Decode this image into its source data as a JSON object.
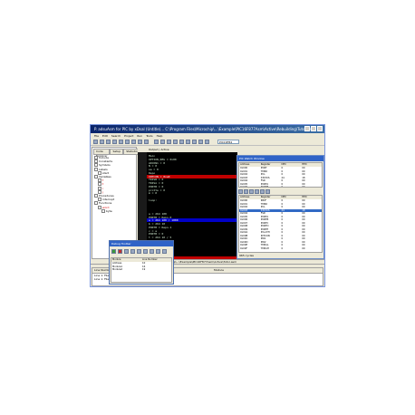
{
  "window": {
    "title": "P. adsuAsm for PIC by xDsal (Untitle)... C:\\Program Files\\Microchip\\...\\Example\\PIC16F877Asm\\Active\\Rebuilding\\Tutor.asm",
    "menu": [
      "File",
      "Edit",
      "Search",
      "Project",
      "Run",
      "Tools",
      "Help"
    ],
    "toolbar_combo": "PIC16F84"
  },
  "left_pane": {
    "tabs": [
      "Code Explorer",
      "Setup",
      "Statistics"
    ],
    "tree": [
      {
        "label": "Include",
        "depth": 1,
        "red": false
      },
      {
        "label": "Constants",
        "depth": 1,
        "red": false
      },
      {
        "label": "Symbols",
        "depth": 1,
        "red": false
      },
      {
        "label": "Labels",
        "depth": 1,
        "red": false
      },
      {
        "label": "start",
        "depth": 2,
        "red": false
      },
      {
        "label": "Variables",
        "depth": 1,
        "red": false
      },
      {
        "label": "f",
        "depth": 2,
        "red": true
      },
      {
        "label": "t",
        "depth": 2,
        "red": true
      },
      {
        "label": "i",
        "depth": 2,
        "red": true
      },
      {
        "label": "j",
        "depth": 2,
        "red": true
      },
      {
        "label": "Procedures",
        "depth": 1,
        "red": false
      },
      {
        "label": "interrupt",
        "depth": 2,
        "red": false
      },
      {
        "label": "Functions",
        "depth": 1,
        "red": false
      },
      {
        "label": "word",
        "depth": 2,
        "red": true
      },
      {
        "label": "byte",
        "depth": 3,
        "red": false
      }
    ]
  },
  "editor": {
    "tab": "Output | Active",
    "lines": [
      {
        "text": "Main",
        "hl": ""
      },
      {
        "text": "OPTION_REG = 0x00",
        "hl": ""
      },
      {
        "text": "ADCON1 = 0",
        "hl": ""
      },
      {
        "text": "N = 0",
        "hl": ""
      },
      {
        "text": "sa = 0",
        "hl": ""
      },
      {
        "text": "Repo",
        "hl": ""
      },
      {
        "text": "INTCON = 0xa0",
        "hl": "red"
      },
      {
        "text": "TRISB = 0",
        "hl": ""
      },
      {
        "text": "TRISA = 0",
        "hl": ""
      },
      {
        "text": "PORTB = 0",
        "hl": ""
      },
      {
        "text": "protte = 0",
        "hl": ""
      },
      {
        "text": "m = 0",
        "hl": ""
      },
      {
        "text": "",
        "hl": ""
      },
      {
        "text": "loop:",
        "hl": ""
      },
      {
        "text": "",
        "hl": ""
      },
      {
        "text": "",
        "hl": ""
      },
      {
        "text": "",
        "hl": ""
      },
      {
        "text": "  a = d64 100",
        "hl": ""
      },
      {
        "text": "  PORTB = Repo.0",
        "hl": ""
      },
      {
        "text": "  a = d64 100 / 1000",
        "hl": "blue"
      },
      {
        "text": "  b = d64 10",
        "hl": ""
      },
      {
        "text": "  PORTB = Repo.1",
        "hl": ""
      },
      {
        "text": "  c = a",
        "hl": ""
      },
      {
        "text": "  PORTB = 0",
        "hl": ""
      },
      {
        "text": "  t = d64 10 / 5",
        "hl": ""
      },
      {
        "text": "  PORTB = Repo.2",
        "hl": ""
      },
      {
        "text": "  PORTB = 0",
        "hl": ""
      },
      {
        "text": "  PORTB AD = 0",
        "hl": ""
      },
      {
        "text": "  PORTB = 0",
        "hl": ""
      },
      {
        "text": "  PORTB = 0",
        "hl": ""
      },
      {
        "text": "  INT = Sleep",
        "hl": "red"
      }
    ],
    "bottom_path": "C:\\Program Files\\Microchip\\...\\Example\\PIC16F877Asm\\Active\\Tutor.asm"
  },
  "debug_panel": {
    "title": "PIC Watch Window",
    "table1": {
      "headers": [
        "Address",
        "Register",
        "DEC",
        "HEX"
      ],
      "rows": [
        [
          "0x000",
          "PORT",
          "0",
          "00"
        ],
        [
          "0x001",
          "TMR0",
          "0",
          "00"
        ],
        [
          "0x002",
          "PCL",
          "0",
          "00"
        ],
        [
          "0x003",
          "STATUS",
          "24",
          "18"
        ],
        [
          "0x004",
          "FSR",
          "0",
          "00"
        ],
        [
          "0x005",
          "PORTA",
          "0",
          "00"
        ],
        [
          "0x006",
          "PORTB",
          "0",
          "00"
        ]
      ]
    },
    "table2": {
      "headers": [
        "Address",
        "Register",
        "DEC",
        "HEX"
      ],
      "rows": [
        [
          "0x000",
          "INDF",
          "0",
          "00"
        ],
        [
          "0x001",
          "TMR0",
          "0",
          "00"
        ],
        [
          "0x002",
          "PCL",
          "0",
          "00"
        ],
        [
          "0x003",
          "STATUS",
          "24",
          "18"
        ],
        [
          "0x004",
          "FSR",
          "0",
          "00"
        ],
        [
          "0x005",
          "PORTA",
          "0",
          "00"
        ],
        [
          "0x006",
          "PORTB",
          "0",
          "00"
        ],
        [
          "0x007",
          "PORTC",
          "0",
          "00"
        ],
        [
          "0x008",
          "PORTD",
          "0",
          "00"
        ],
        [
          "0x009",
          "PORTE",
          "0",
          "00"
        ],
        [
          "0x00A",
          "PCLATH",
          "0",
          "00"
        ],
        [
          "0x00B",
          "INTCON",
          "0",
          "00"
        ],
        [
          "0x00C",
          "PIR1",
          "0",
          "00"
        ],
        [
          "0x00D",
          "PIR2",
          "0",
          "00"
        ],
        [
          "0x00E",
          "TMR1L",
          "0",
          "00"
        ],
        [
          "0x00F",
          "TMR1H",
          "0",
          "00"
        ]
      ]
    },
    "footer": "965 cycles"
  },
  "output": {
    "headers": [
      "Line Number",
      "Module"
    ],
    "lines": [
      "Line 1: File...",
      "Line 1: File..."
    ]
  },
  "popup": {
    "title": "Debug Toolbar",
    "headers": [
      "Module",
      "Line Number"
    ],
    "rows": [
      [
        "Address",
        "10"
      ],
      [
        "Module1",
        "16"
      ],
      [
        "Module2",
        "19"
      ]
    ]
  }
}
